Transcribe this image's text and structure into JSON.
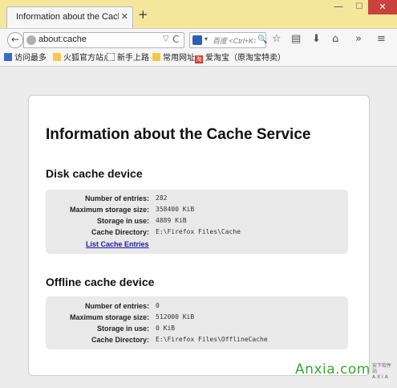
{
  "window": {
    "tab_title": "Information about the Cache S",
    "tab_close": "✕",
    "new_tab": "+",
    "minimize": "—",
    "maximize": "☐",
    "close": "✕"
  },
  "navbar": {
    "back": "←",
    "url": "about:cache",
    "url_dropdown": "▽",
    "reload": "C",
    "search_engine_glyph": "🐾",
    "search_dropdown": "▾",
    "search_placeholder": "百度 <Ctrl+K>",
    "search_go": "🔍",
    "star": "☆",
    "reader": "▤",
    "download": "⬇",
    "home": "⌂",
    "overflow": "»",
    "menu": "≡"
  },
  "bookmarks": {
    "items": [
      {
        "label": "访问最多",
        "icon": "star-icon"
      },
      {
        "label": "火狐官方站点",
        "icon": "folder-icon"
      },
      {
        "label": "新手上路",
        "icon": "page-icon"
      },
      {
        "label": "常用网址",
        "icon": "folder-icon"
      },
      {
        "label": "爱淘宝（原淘宝特卖）",
        "icon": "taobao-icon"
      }
    ],
    "taobao_glyph": "淘"
  },
  "page": {
    "title": "Information about the Cache Service",
    "disk": {
      "heading": "Disk cache device",
      "rows": [
        {
          "label": "Number of entries:",
          "value": "282"
        },
        {
          "label": "Maximum storage size:",
          "value": "358400 KiB"
        },
        {
          "label": "Storage in use:",
          "value": "4889 KiB"
        },
        {
          "label": "Cache Directory:",
          "value": "E:\\Firefox Files\\Cache"
        }
      ],
      "link": "List Cache Entries"
    },
    "offline": {
      "heading": "Offline cache device",
      "rows": [
        {
          "label": "Number of entries:",
          "value": "0"
        },
        {
          "label": "Maximum storage size:",
          "value": "512000 KiB"
        },
        {
          "label": "Storage in use:",
          "value": "0 KiB"
        },
        {
          "label": "Cache Directory:",
          "value": "E:\\Firefox Files\\OfflineCache"
        }
      ]
    }
  },
  "watermark": {
    "main": "Anxia.com",
    "sub_line1": "安下软件站",
    "sub_line2": "A X I A"
  },
  "colors": {
    "titlebar": "#f4e79b",
    "link": "#1a1aa6",
    "watermark": "#3aa52f",
    "close_button": "#c8433b"
  }
}
